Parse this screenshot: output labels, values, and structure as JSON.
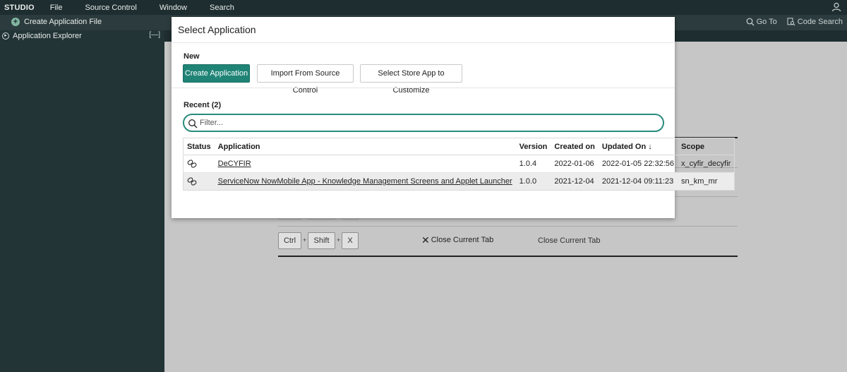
{
  "menubar": {
    "brand": "STUDIO",
    "items": [
      "File",
      "Source Control",
      "Window",
      "Search"
    ]
  },
  "toolbar": {
    "create_file_label": "Create Application File",
    "goto_label": "Go To",
    "code_search_label": "Code Search"
  },
  "sidebar": {
    "title": "Application Explorer",
    "minimize_glyph": "[—]"
  },
  "background": {
    "keys": [
      "Ctrl",
      "Shift",
      "X"
    ],
    "plus": "+",
    "close_tab_label": "Close Current Tab",
    "close_tab_desc": "Close Current Tab"
  },
  "modal": {
    "title": "Select Application",
    "new_heading": "New",
    "buttons": {
      "create": "Create Application",
      "import": "Import From Source Control",
      "store": "Select Store App to Customize"
    },
    "recent_heading": "Recent (2)",
    "filter_placeholder": "Filter...",
    "table": {
      "headers": {
        "status": "Status",
        "application": "Application",
        "version": "Version",
        "created": "Created on",
        "updated": "Updated On",
        "scope": "Scope"
      },
      "sort_indicator": "↓",
      "rows": [
        {
          "application": "DeCYFIR",
          "version": "1.0.4",
          "created": "2022-01-06",
          "updated": "2022-01-05 22:32:56",
          "scope": "x_cyfir_decyfir"
        },
        {
          "application": "ServiceNow NowMobile App - Knowledge Management Screens and Applet Launcher",
          "version": "1.0.0",
          "created": "2021-12-04",
          "updated": "2021-12-04 09:11:23",
          "scope": "sn_km_mr"
        }
      ]
    }
  },
  "colors": {
    "primary_button": "#1f8476",
    "filter_border": "#2a8b7c",
    "menubar_bg": "#1e2d2f",
    "sidebar_bg": "#223436"
  }
}
